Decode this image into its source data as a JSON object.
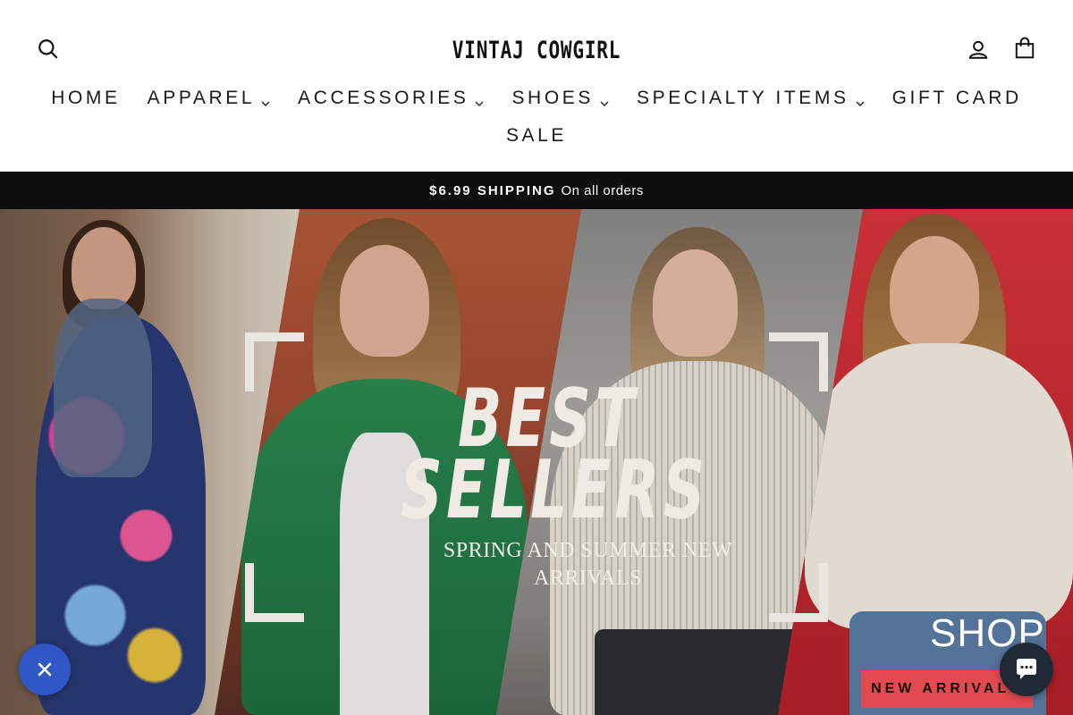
{
  "brand": {
    "logo_text": "VINTAJ COWGIRL"
  },
  "header": {
    "icons": {
      "search": "search-icon",
      "account": "user-icon",
      "cart": "shopping-bag-icon"
    }
  },
  "nav": {
    "row1": [
      {
        "label": "HOME",
        "has_dropdown": false
      },
      {
        "label": "APPAREL",
        "has_dropdown": true
      },
      {
        "label": "ACCESSORIES",
        "has_dropdown": true
      },
      {
        "label": "SHOES",
        "has_dropdown": true
      },
      {
        "label": "SPECIALTY ITEMS",
        "has_dropdown": true
      },
      {
        "label": "GIFT CARD",
        "has_dropdown": false
      }
    ],
    "row2": [
      {
        "label": "SALE",
        "has_dropdown": false
      }
    ]
  },
  "announcement": {
    "strong": "$6.99 SHIPPING",
    "text": "On all orders"
  },
  "hero": {
    "title_line1": "BEST",
    "title_line2": "SELLERS",
    "subtitle_line1": "SPRING AND SUMMER NEW",
    "subtitle_line2": "ARRIVALS",
    "shop_text": "SHOP",
    "button_label": "NEW ARRIVALS"
  },
  "widgets": {
    "close_icon": "close-icon",
    "chat_icon": "chat-icon"
  },
  "colors": {
    "announcement_bg": "#0e0e0e",
    "hero_button_bg": "#e34a4f",
    "close_bubble_bg": "#2f58c6",
    "chat_bubble_bg": "#1f2a36"
  }
}
